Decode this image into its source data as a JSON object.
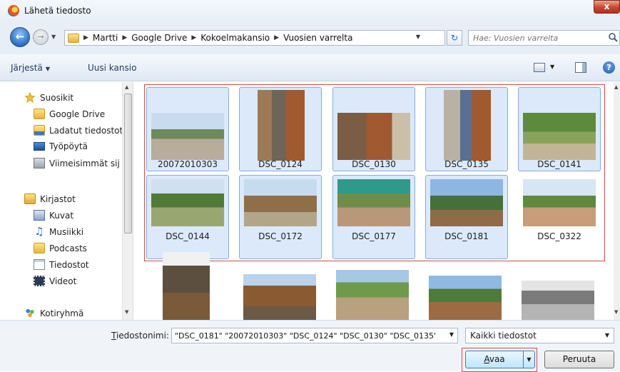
{
  "window": {
    "title": "Lähetä tiedosto",
    "close_label": "x"
  },
  "address": {
    "crumbs": [
      "Martti",
      "Google Drive",
      "Kokoelmakansio",
      "Vuosien varrelta"
    ],
    "search_placeholder": "Hae: Vuosien varrelta"
  },
  "toolbar": {
    "organize_label": "Järjestä",
    "new_folder_label": "Uusi kansio"
  },
  "nav": {
    "favorites_label": "Suosikit",
    "favorites": [
      "Google Drive",
      "Ladatut tiedostot",
      "Työpöytä",
      "Viimeisimmät sij"
    ],
    "libraries_label": "Kirjastot",
    "libraries": [
      "Kuvat",
      "Musiikki",
      "Podcasts",
      "Tiedostot",
      "Videot"
    ],
    "homegroup_label": "Kotiryhmä"
  },
  "files": [
    {
      "name": "20072010303",
      "selected": true
    },
    {
      "name": "DSC_0124",
      "selected": true
    },
    {
      "name": "DSC_0130",
      "selected": true
    },
    {
      "name": "DSC_0135",
      "selected": true
    },
    {
      "name": "DSC_0141",
      "selected": true
    },
    {
      "name": "DSC_0144",
      "selected": true
    },
    {
      "name": "DSC_0172",
      "selected": true
    },
    {
      "name": "DSC_0177",
      "selected": true
    },
    {
      "name": "DSC_0181",
      "selected": true
    },
    {
      "name": "DSC_0322",
      "selected": false
    }
  ],
  "bottom": {
    "filename_label_accel": "T",
    "filename_label_rest": "iedostonimi:",
    "filename_value": "\"DSC_0181\" \"20072010303\" \"DSC_0124\" \"DSC_0130\" \"DSC_0135\"",
    "filetype_value": "Kaikki tiedostot",
    "open_accel": "A",
    "open_rest": "vaa",
    "cancel_label": "Peruuta"
  },
  "colors": {
    "selection_fill": "#dbe9fb",
    "selection_border": "#84acdd",
    "highlight_outline": "#d64a4a"
  }
}
